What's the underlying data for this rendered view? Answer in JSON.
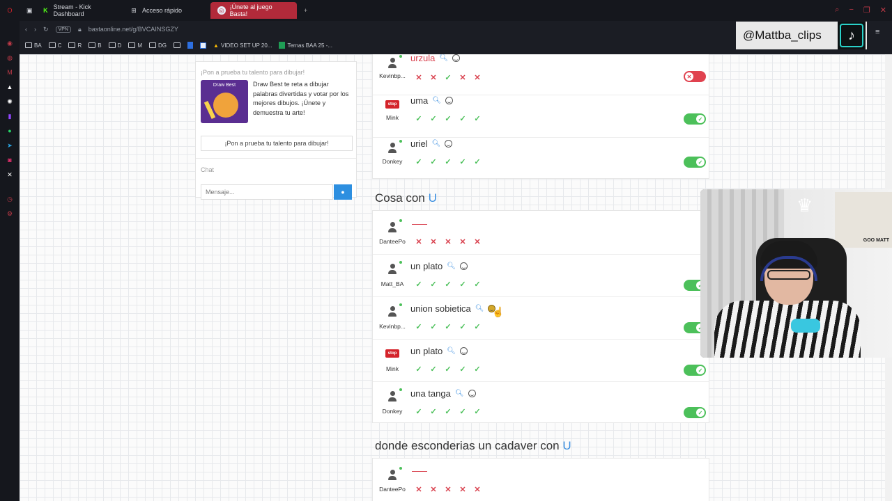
{
  "browser": {
    "tabs": [
      {
        "label": "Stream - Kick Dashboard",
        "icon": "kick-icon",
        "active": false
      },
      {
        "label": "Acceso rápido",
        "icon": "grid-icon",
        "active": false
      },
      {
        "label": "¡Únete al juego Basta!",
        "icon": "basta-icon",
        "active": true
      }
    ],
    "new_tab": "+",
    "vpn_label": "VPN",
    "url": "bastaonline.net/g/BVCAINSGZY",
    "bookmarks": [
      "BA",
      "C",
      "R",
      "B",
      "D",
      "M",
      "DG",
      "",
      "",
      "VIDEO SET UP 20...",
      "Ternas BAA 25 -..."
    ]
  },
  "promo": {
    "title": "¡Pon a prueba tu talento para dibujar!",
    "image_title": "Draw Best",
    "text": "Draw Best te reta a dibujar palabras divertidas y votar por los mejores dibujos. ¡Únete y demuestra tu arte!",
    "button": "¡Pon a prueba tu talento para dibujar!"
  },
  "chat": {
    "label": "Chat",
    "placeholder": "Mensaje..."
  },
  "top_rows": [
    {
      "user": "Kevinbp...",
      "word": "urzula",
      "word_red": true,
      "avatar": "person",
      "votes": [
        "no",
        "no",
        "ok",
        "no",
        "no"
      ],
      "toggle": "off"
    },
    {
      "user": "Mink",
      "word": "uma",
      "word_red": false,
      "avatar": "stop",
      "votes": [
        "ok",
        "ok",
        "ok",
        "ok",
        "ok"
      ],
      "toggle": "on"
    },
    {
      "user": "Donkey",
      "word": "uriel",
      "word_red": false,
      "avatar": "person",
      "votes": [
        "ok",
        "ok",
        "ok",
        "ok",
        "ok"
      ],
      "toggle": "on"
    }
  ],
  "section_cosa": {
    "title": "Cosa con",
    "letter": "U",
    "rows": [
      {
        "user": "DanteePo",
        "word": "",
        "empty": true,
        "avatar": "person",
        "votes": [
          "no",
          "no",
          "no",
          "no",
          "no"
        ],
        "toggle": "none"
      },
      {
        "user": "Matt_BA",
        "word": "un plato",
        "avatar": "person",
        "votes": [
          "ok",
          "ok",
          "ok",
          "ok",
          "ok"
        ],
        "toggle": "on"
      },
      {
        "user": "Kevinbp...",
        "word": "union sobietica",
        "avatar": "person",
        "votes": [
          "ok",
          "ok",
          "ok",
          "ok",
          "ok"
        ],
        "toggle": "on"
      },
      {
        "user": "Mink",
        "word": "un plato",
        "avatar": "stop",
        "votes": [
          "ok",
          "ok",
          "ok",
          "ok",
          "ok"
        ],
        "toggle": "on"
      },
      {
        "user": "Donkey",
        "word": "una tanga",
        "avatar": "person",
        "votes": [
          "ok",
          "ok",
          "ok",
          "ok",
          "ok"
        ],
        "toggle": "on"
      }
    ]
  },
  "section_cadaver": {
    "title": "donde esconderias un cadaver con",
    "letter": "U",
    "rows": [
      {
        "user": "DanteePo",
        "word": "",
        "empty": true,
        "avatar": "person",
        "votes": [
          "no",
          "no",
          "no",
          "no",
          "no"
        ],
        "toggle": "none"
      }
    ]
  },
  "stop_label": "stop",
  "overlay": {
    "handle": "@Mattba_clips",
    "poster_text": "GOO MATT"
  }
}
